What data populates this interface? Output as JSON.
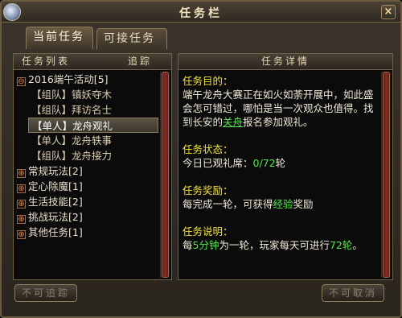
{
  "window": {
    "title": "任务栏"
  },
  "tabs": [
    {
      "label": "当前任务",
      "active": true
    },
    {
      "label": "可接任务",
      "active": false
    }
  ],
  "list": {
    "header_left": "任务列表",
    "header_right": "追踪",
    "groups": [
      {
        "expander": "⊖",
        "label": "2016端午活动[5]"
      },
      {
        "expander": "⊕",
        "label": "常规玩法[2]"
      },
      {
        "expander": "⊕",
        "label": "定心除魔[1]"
      },
      {
        "expander": "⊕",
        "label": "生活技能[2]"
      },
      {
        "expander": "⊕",
        "label": "挑战玩法[2]"
      },
      {
        "expander": "⊕",
        "label": "其他任务[1]"
      }
    ],
    "items": [
      {
        "label": "【组队】镇妖夺木"
      },
      {
        "label": "【组队】拜访名士"
      },
      {
        "label": "【单人】龙舟观礼",
        "selected": true
      },
      {
        "label": "【单人】龙舟轶事"
      },
      {
        "label": "【组队】龙舟接力"
      }
    ]
  },
  "detail": {
    "header": "任务详情",
    "goal_label": "任务目的：",
    "goal_text_1": "端午龙舟大赛正在如火如荼开展中，如此盛会怎可错过，哪怕是当一次观众也值得。找到长安的",
    "goal_link": "关舟",
    "goal_text_2": "报名参加观礼。",
    "status_label": "任务状态：",
    "status_text": "今日已观礼席：",
    "status_value": "0/72",
    "status_unit": "轮",
    "reward_label": "任务奖励：",
    "reward_text_1": "每完成一轮，可获得",
    "reward_highlight": "经验",
    "reward_text_2": "奖励",
    "desc_label": "任务说明：",
    "desc_text_1": "每",
    "desc_highlight_1": "5分钟",
    "desc_text_2": "为一轮，玩家每天可进行",
    "desc_highlight_2": "72轮",
    "desc_text_3": "。"
  },
  "buttons": {
    "track": "不可追踪",
    "cancel": "不可取消"
  },
  "colors": {
    "highlight": "#52e84a",
    "section_label": "#f2e23a"
  }
}
